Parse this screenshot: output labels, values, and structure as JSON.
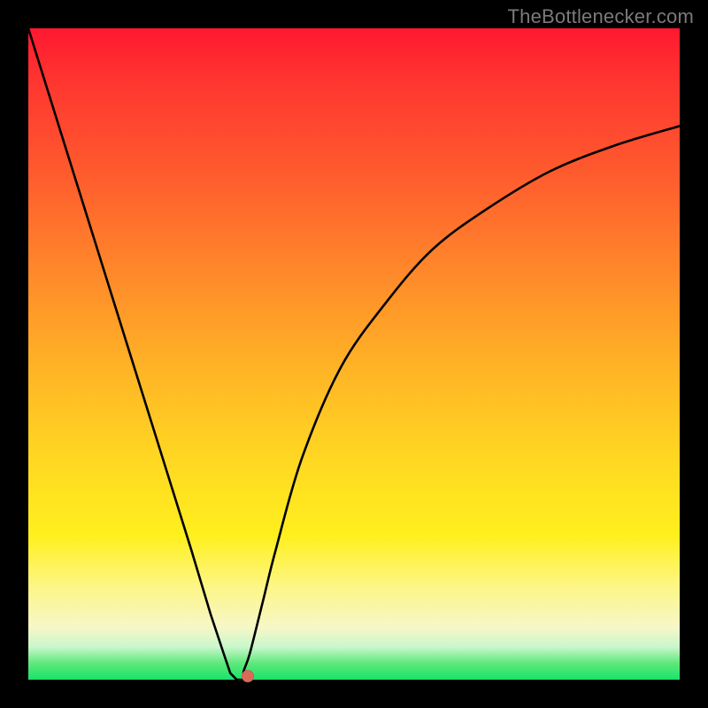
{
  "watermark": "TheBottlenecker.com",
  "chart_data": {
    "type": "line",
    "title": "",
    "xlabel": "",
    "ylabel": "",
    "xlim": [
      0,
      100
    ],
    "ylim": [
      0,
      100
    ],
    "x": [
      0,
      5,
      10,
      15,
      20,
      25,
      28,
      30,
      31,
      32,
      33,
      34,
      36,
      38,
      42,
      48,
      55,
      62,
      70,
      80,
      90,
      100
    ],
    "values": [
      100,
      84,
      68,
      52,
      36,
      20,
      10,
      4,
      1,
      0,
      1,
      4,
      12,
      20,
      34,
      48,
      58,
      66,
      72,
      78,
      82,
      85
    ],
    "marker": {
      "x": 32,
      "y": 0
    },
    "notes": "V-shaped bottleneck curve; minimum (green/optimal) near x≈32. Values are approximate, read from gradient position."
  },
  "colors": {
    "curve": "#000000",
    "dot": "#d86a5a",
    "background_top": "#ff1830",
    "background_bottom": "#19e36a"
  }
}
